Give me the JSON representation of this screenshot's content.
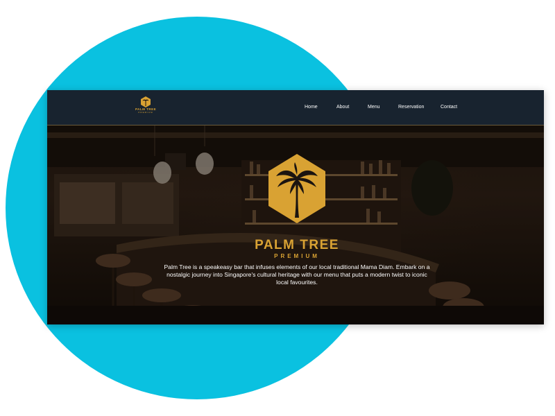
{
  "nav": {
    "logo_text": "PALM TREE",
    "logo_sub": "PREMIUM",
    "links": [
      "Home",
      "About",
      "Menu",
      "Reservation",
      "Contact"
    ]
  },
  "hero": {
    "brand_title": "PALM TREE",
    "brand_sub": "PREMIUM",
    "description": "Palm Tree is a speakeasy bar that infuses elements of our local traditional Mama Diam. Embark on a nostalgic journey into Singapore's cultural heritage with our menu that puts a modern twist to iconic local favourites."
  },
  "colors": {
    "accent": "#0ac1e0",
    "brand_gold": "#d9a233",
    "navbar_bg": "#18232f"
  },
  "icons": {
    "logo": "palm-tree-hexagon-icon"
  }
}
